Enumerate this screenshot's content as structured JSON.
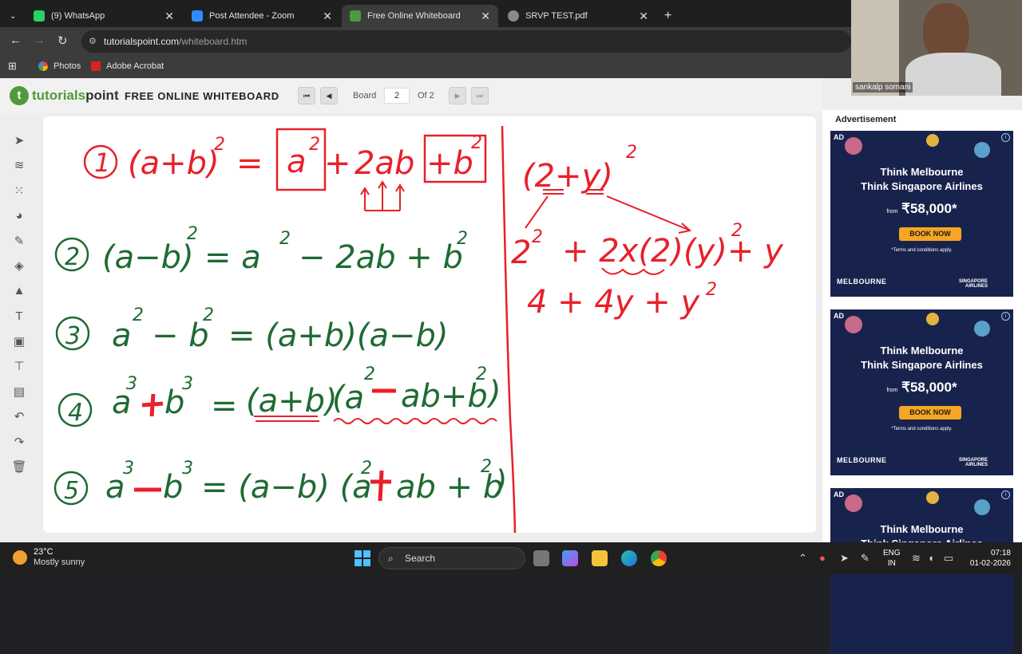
{
  "browser": {
    "tabs": [
      {
        "label": "(9) WhatsApp",
        "active": false,
        "color": "#25d366"
      },
      {
        "label": "Post Attendee - Zoom",
        "active": false,
        "color": "#2d8cff"
      },
      {
        "label": "Free Online Whiteboard",
        "active": true,
        "color": "#4f9a3a"
      },
      {
        "label": "SRVP TEST.pdf",
        "active": false,
        "color": "#8a8a8a"
      }
    ],
    "url_host": "tutorialspoint.com",
    "url_path": "/whiteboard.htm",
    "bookmarks": [
      {
        "label": "Photos",
        "icon": "photos-icon"
      },
      {
        "label": "Adobe Acrobat",
        "icon": "acrobat-icon"
      }
    ]
  },
  "app": {
    "logo_text_1": "tutorials",
    "logo_text_2": "point",
    "title": "FREE ONLINE WHITEBOARD",
    "board_label": "Board",
    "board_value": "2",
    "board_total": "Of 2"
  },
  "toolbar": [
    {
      "name": "select-tool",
      "glyph": "➤"
    },
    {
      "name": "layers-tool",
      "glyph": "≋"
    },
    {
      "name": "grid-tool",
      "glyph": "⁙"
    },
    {
      "name": "palette-tool",
      "glyph": "◕"
    },
    {
      "name": "pen-tool",
      "glyph": "✎"
    },
    {
      "name": "eraser-tool",
      "glyph": "◈"
    },
    {
      "name": "shapes-tool",
      "glyph": "▲"
    },
    {
      "name": "text-tool",
      "glyph": "T"
    },
    {
      "name": "image-tool",
      "glyph": "▣"
    },
    {
      "name": "presenter-tool",
      "glyph": "⊤"
    },
    {
      "name": "screen-tool",
      "glyph": "▤"
    },
    {
      "name": "undo-tool",
      "glyph": "↶"
    },
    {
      "name": "redo-tool",
      "glyph": "↷"
    },
    {
      "name": "delete-tool",
      "glyph": "🗑"
    }
  ],
  "whiteboard": {
    "red": "#e8202a",
    "green": "#1e6b33",
    "num_1": "1",
    "num_2": "2",
    "num_3": "3",
    "num_4": "4",
    "num_5": "5",
    "f1_lhs": "(a+b)",
    "exp2": "2",
    "exp3": "3",
    "f1_eq": "=",
    "f1_a": "a",
    "f1_plus": "+",
    "f1_2ab": "2ab",
    "f1_b": "+b",
    "f2_lhs": "(a−b)",
    "f2_rhs1": "=  a",
    "f2_rhs2": "− 2ab + b",
    "f3_a": "a",
    "f3_mid": "− b",
    "f3_rhs": "= (a+b)(a−b)",
    "f4_a": "a",
    "f4_b": "b",
    "f4_eq": "=",
    "f4_ab": "(a+b)",
    "f4_rest": "(a",
    "f4_mid": "ab+b",
    "f4_close": ")",
    "f5_a": "a",
    "f5_b": "b",
    "f5_rhs": "= (a−b) (a",
    "f5_mid": "ab + b",
    "f5_close": ")",
    "r1_base": "(2+y)",
    "r2_a": "2",
    "r2_b": "+ 2x(2)(y)+ y",
    "r3": "4 +   4y + y"
  },
  "ads": {
    "heading": "Advertisement",
    "items": [
      {
        "tag": "AD",
        "line1": "Think Melbourne",
        "line2": "Think Singapore Airlines",
        "price_from": "from",
        "price": "₹58,000*",
        "button": "BOOK NOW",
        "terms": "*Terms and conditions apply.",
        "brand1": "MELBOURNE",
        "brand2": "SINGAPORE AIRLINES"
      },
      {
        "tag": "AD",
        "line1": "Think Melbourne",
        "line2": "Think Singapore Airlines",
        "price_from": "from",
        "price": "₹58,000*",
        "button": "BOOK NOW",
        "terms": "*Terms and conditions apply.",
        "brand1": "MELBOURNE",
        "brand2": "SINGAPORE AIRLINES"
      },
      {
        "tag": "AD",
        "line1": "Think Melbourne",
        "line2": "Think Singapore Airlines"
      }
    ]
  },
  "video": {
    "name": "sankalp somani"
  },
  "taskbar": {
    "temperature": "23°C",
    "weather": "Mostly sunny",
    "search": "Search",
    "lang1": "ENG",
    "lang2": "IN",
    "time": "07:18",
    "date": "01-02-2026"
  }
}
